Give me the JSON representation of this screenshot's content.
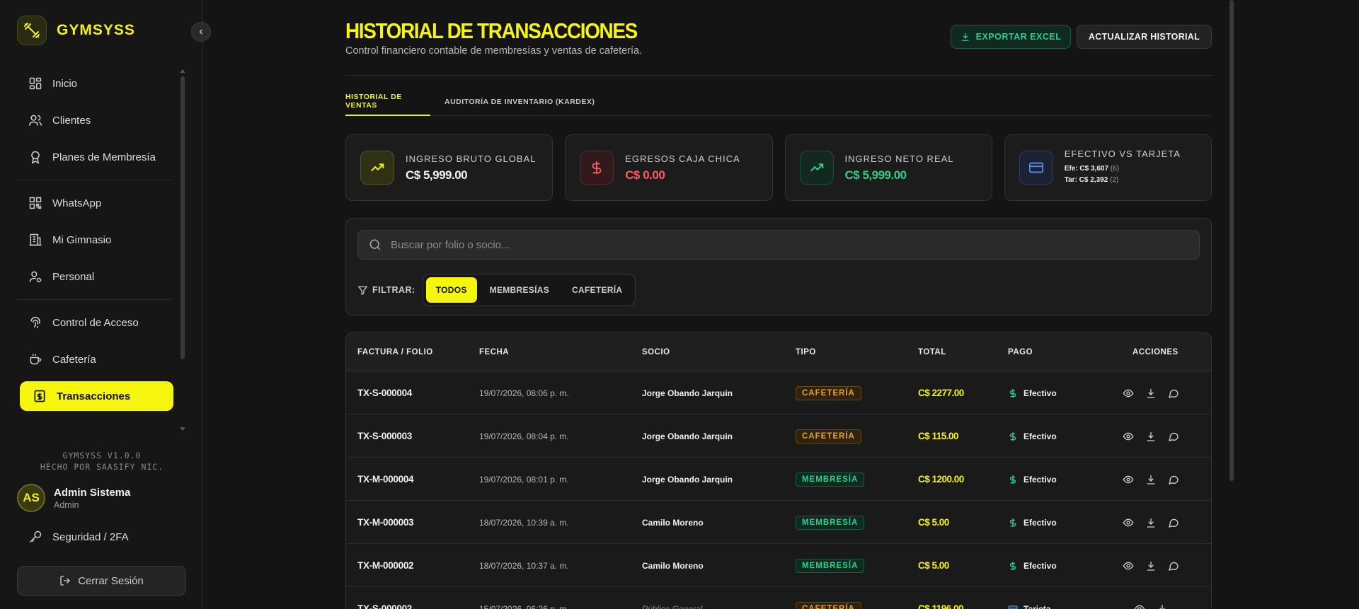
{
  "sidebar": {
    "brand": "GYMSYSS",
    "nav": [
      {
        "label": "Inicio",
        "icon": "dashboard-icon"
      },
      {
        "label": "Clientes",
        "icon": "users-icon"
      },
      {
        "label": "Planes de Membresía",
        "icon": "award-icon"
      },
      {
        "label": "WhatsApp",
        "icon": "qr-icon"
      },
      {
        "label": "Mi Gimnasio",
        "icon": "building-icon"
      },
      {
        "label": "Personal",
        "icon": "user-cog-icon"
      },
      {
        "label": "Control de Acceso",
        "icon": "fingerprint-icon"
      },
      {
        "label": "Cafetería",
        "icon": "coffee-icon"
      },
      {
        "label": "Transacciones",
        "icon": "receipt-icon",
        "active": true
      }
    ],
    "version_line1": "GYMSYSS V1.0.0",
    "version_line2": "HECHO POR SAASIFY NIC.",
    "user": {
      "initials": "AS",
      "name": "Admin Sistema",
      "role": "Admin"
    },
    "security": "Seguridad / 2FA",
    "logout": "Cerrar Sesión"
  },
  "header": {
    "title": "HISTORIAL DE TRANSACCIONES",
    "subtitle": "Control financiero contable de membresías y ventas de cafetería.",
    "export_label": "EXPORTAR EXCEL",
    "refresh_label": "ACTUALIZAR HISTORIAL"
  },
  "tabs": [
    {
      "label": "HISTORIAL DE VENTAS",
      "active": true
    },
    {
      "label": "AUDITORÍA DE INVENTARIO (KARDEX)",
      "active": false
    }
  ],
  "cards": [
    {
      "label": "INGRESO BRUTO GLOBAL",
      "value": "C$ 5,999.00",
      "color": "#f2f2f2"
    },
    {
      "label": "EGRESOS CAJA CHICA",
      "value": "C$ 0.00",
      "color": "#ff5a5f"
    },
    {
      "label": "INGRESO NETO REAL",
      "value": "C$ 5,999.00",
      "color": "#2ecf8a"
    },
    {
      "label": "EFECTIVO VS TARJETA",
      "line1": "Efe: C$ 3,607",
      "line1_count": "(6)",
      "line2": "Tar: C$ 2,392",
      "line2_count": "(2)"
    }
  ],
  "search": {
    "placeholder": "Buscar por folio o socio..."
  },
  "filter": {
    "label": "FILTRAR:",
    "options": [
      "TODOS",
      "MEMBRESÍAS",
      "CAFETERÍA"
    ],
    "selected": "TODOS"
  },
  "table": {
    "columns": [
      "FACTURA / FOLIO",
      "FECHA",
      "SOCIO",
      "TIPO",
      "TOTAL",
      "PAGO",
      "ACCIONES"
    ],
    "rows": [
      {
        "folio": "TX-S-000004",
        "fecha": "19/07/2026, 08:06 p. m.",
        "socio": "Jorge Obando Jarquin",
        "tipo": "CAFETERÍA",
        "total": "C$ 2277.00",
        "pago": "Efectivo"
      },
      {
        "folio": "TX-S-000003",
        "fecha": "19/07/2026, 08:04 p. m.",
        "socio": "Jorge Obando Jarquin",
        "tipo": "CAFETERÍA",
        "total": "C$ 115.00",
        "pago": "Efectivo"
      },
      {
        "folio": "TX-M-000004",
        "fecha": "19/07/2026, 08:01 p. m.",
        "socio": "Jorge Obando Jarquin",
        "tipo": "MEMBRESÍA",
        "total": "C$ 1200.00",
        "pago": "Efectivo"
      },
      {
        "folio": "TX-M-000003",
        "fecha": "18/07/2026, 10:39 a. m.",
        "socio": "Camilo Moreno",
        "tipo": "MEMBRESÍA",
        "total": "C$ 5.00",
        "pago": "Efectivo"
      },
      {
        "folio": "TX-M-000002",
        "fecha": "18/07/2026, 10:37 a. m.",
        "socio": "Camilo Moreno",
        "tipo": "MEMBRESÍA",
        "total": "C$ 5.00",
        "pago": "Efectivo"
      },
      {
        "folio": "TX-S-000002",
        "fecha": "15/07/2026, 06:26 p. m.",
        "socio": "Público General",
        "tipo": "CAFETERÍA",
        "total": "C$ 1196.00",
        "pago": "Tarjeta"
      }
    ]
  },
  "colors": {
    "accent": "#f5f50d",
    "success": "#2ecf8a",
    "danger": "#ff5a5f",
    "warning": "#f0a020"
  }
}
